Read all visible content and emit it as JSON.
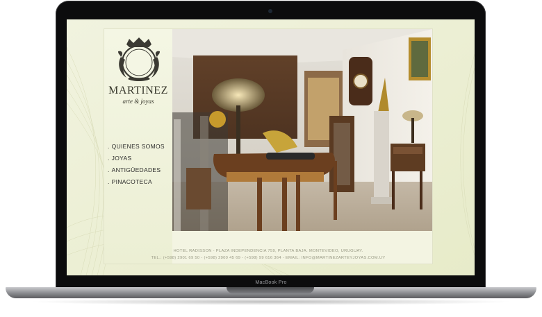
{
  "device": {
    "label": "MacBook Pro"
  },
  "site": {
    "brand": {
      "name": "MARTINEZ",
      "tagline": "arte & joyas",
      "monogram": "M"
    },
    "menu": [
      {
        "label": "QUIENES SOMOS"
      },
      {
        "label": "JOYAS"
      },
      {
        "label": "ANTIGÜEDADES"
      },
      {
        "label": "PINACOTECA"
      }
    ],
    "footer": {
      "address": "HOTEL RADISSON - PLAZA INDEPENDENCIA 759, PLANTA BAJA. MONTEVIDEO, URUGUAY.",
      "contact": "TEL.: (+598) 2901 69 50 - (+598) 2900 45 69 - (+598) 99 616 364 - EMAIL: INFO@MARTINEZARTEYJOYAS.COM.UY"
    }
  },
  "colors": {
    "screen_bg": "#eef1dd",
    "text_dark": "#2b2b2b",
    "footer_text": "#9a9b86"
  }
}
